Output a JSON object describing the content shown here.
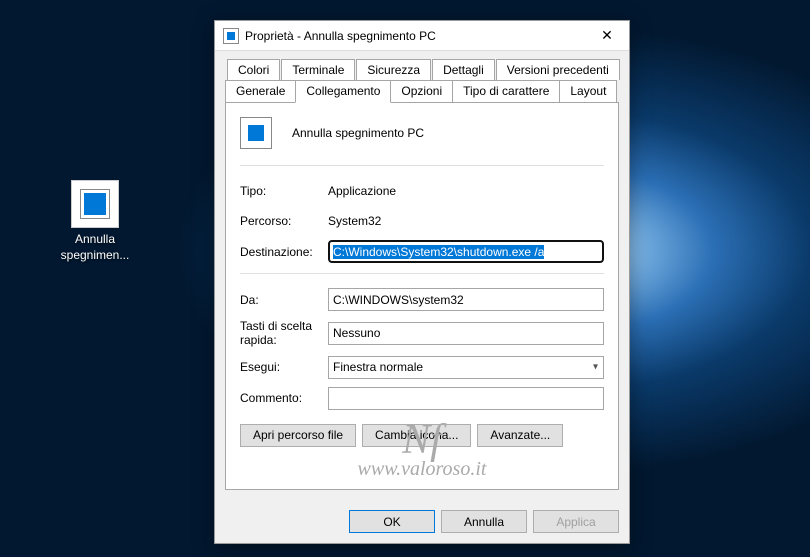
{
  "desktop": {
    "icon_label": "Annulla spegnimen..."
  },
  "dialog": {
    "title": "Proprietà - Annulla spegnimento PC",
    "tabs_row1": [
      "Colori",
      "Terminale",
      "Sicurezza",
      "Dettagli",
      "Versioni precedenti"
    ],
    "tabs_row2": [
      "Generale",
      "Collegamento",
      "Opzioni",
      "Tipo di carattere",
      "Layout"
    ],
    "active_tab": "Collegamento",
    "shortcut_name": "Annulla spegnimento PC",
    "labels": {
      "tipo": "Tipo:",
      "percorso": "Percorso:",
      "destinazione": "Destinazione:",
      "da": "Da:",
      "tasti": "Tasti di scelta rapida:",
      "esegui": "Esegui:",
      "commento": "Commento:"
    },
    "values": {
      "tipo": "Applicazione",
      "percorso": "System32",
      "destinazione": "C:\\Windows\\System32\\shutdown.exe /a",
      "da": "C:\\WINDOWS\\system32",
      "tasti": "Nessuno",
      "esegui": "Finestra normale",
      "commento": ""
    },
    "buttons": {
      "apri": "Apri percorso file",
      "icona": "Cambia icona...",
      "avanzate": "Avanzate..."
    },
    "footer": {
      "ok": "OK",
      "annulla": "Annulla",
      "applica": "Applica"
    }
  },
  "watermark": {
    "monogram": "Nf",
    "url": "www.valoroso.it"
  }
}
